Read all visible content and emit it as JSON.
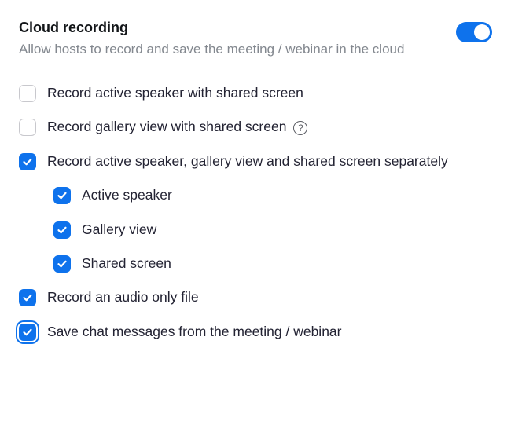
{
  "header": {
    "title": "Cloud recording",
    "subtitle": "Allow hosts to record and save the meeting / webinar in the cloud",
    "enabled": true
  },
  "options": {
    "record_active_speaker_shared": {
      "label": "Record active speaker with shared screen",
      "checked": false
    },
    "record_gallery_shared": {
      "label": "Record gallery view with shared screen",
      "checked": false,
      "help": true
    },
    "record_separately": {
      "label": "Record active speaker, gallery view and shared screen separately",
      "checked": true,
      "children": {
        "active_speaker": {
          "label": "Active speaker",
          "checked": true
        },
        "gallery_view": {
          "label": "Gallery view",
          "checked": true
        },
        "shared_screen": {
          "label": "Shared screen",
          "checked": true
        }
      }
    },
    "audio_only": {
      "label": "Record an audio only file",
      "checked": true
    },
    "save_chat": {
      "label": "Save chat messages from the meeting / webinar",
      "checked": true,
      "focused": true
    }
  }
}
